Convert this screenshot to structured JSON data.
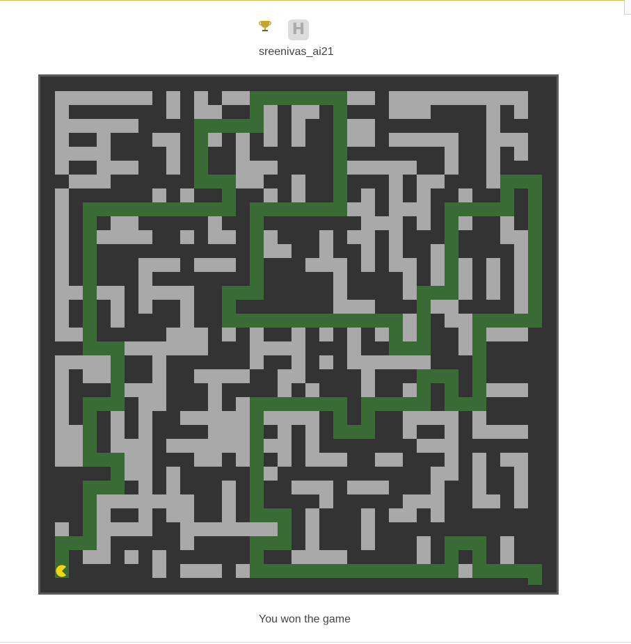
{
  "header": {
    "badge_letter": "H",
    "player_name": "sreenivas_ai21"
  },
  "status": {
    "message": "You won the game"
  },
  "maze": {
    "grid_size": 37,
    "colors": {
      "wall": "#333333",
      "border": "#5b5b5b",
      "open_floor": "#a9a9a9",
      "solution_path": "#3a6b35",
      "player": "#f2d70d",
      "trophy": "#c9a42b"
    },
    "player_position": {
      "row": 35,
      "col": 1
    },
    "game_state": "won"
  }
}
